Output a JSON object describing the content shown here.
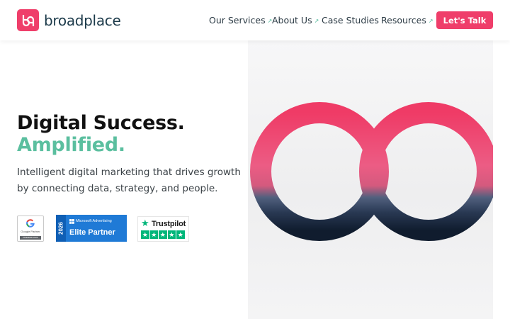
{
  "header": {
    "brand": "broadplace",
    "logo_mark": "bp",
    "nav": [
      {
        "label": "Our Services",
        "arrow": "↗"
      },
      {
        "label": "About Us",
        "arrow": "↗"
      },
      {
        "label": "Case Studies",
        "arrow": ""
      },
      {
        "label": "Resources",
        "arrow": "↗"
      }
    ],
    "cta_label": "Let's Talk"
  },
  "hero": {
    "headline_line1": "Digital Success.",
    "headline_line2": "Amplified.",
    "subtext": "Intelligent digital marketing that drives growth by connecting data, strategy, and people."
  },
  "badges": {
    "google": {
      "partner": "Google Partner",
      "bar": "PREMIER 2025"
    },
    "microsoft": {
      "year": "2026",
      "label": "Microsoft Advertising",
      "title": "Elite Partner"
    },
    "trustpilot": {
      "name": "Trustpilot",
      "star": "★",
      "rating_stars": [
        "★",
        "★",
        "★",
        "★",
        "★"
      ]
    }
  },
  "colors": {
    "brand_pink": "#ef3e6a",
    "accent_green": "#5bbf9f",
    "navy": "#1c3a4a"
  }
}
